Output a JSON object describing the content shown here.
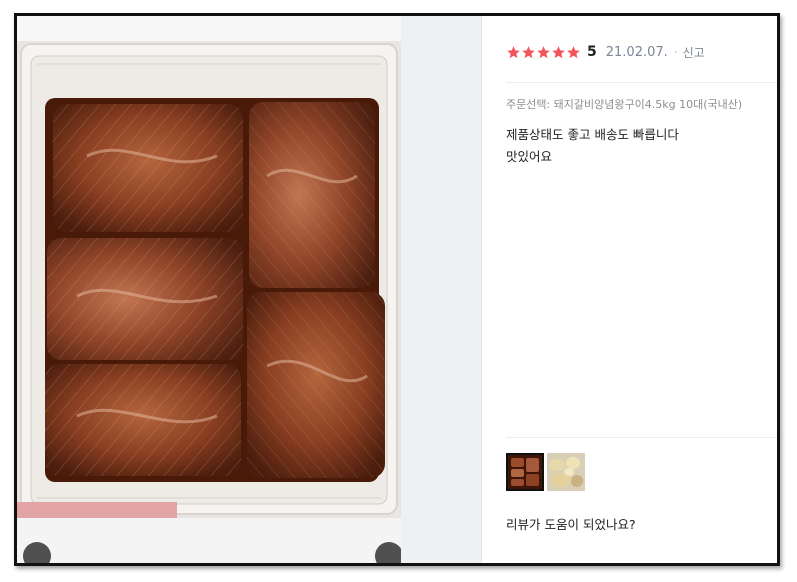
{
  "review": {
    "rating": 5,
    "score_label": "5",
    "date": "21.02.07.",
    "separator": "·",
    "report_label": "신고",
    "order_option": "주문선택: 돼지갈비양념왕구이4.5kg 10대(국내산)",
    "content_lines": [
      "제품상태도 좋고 배송도 빠릅니다",
      "맛있어요"
    ],
    "helpful_question": "리뷰가 도움이 되었나요?"
  },
  "photos": {
    "main_photo_icon": "marinated-pork-ribs-photo",
    "thumbnails": [
      "pork-ribs-thumbnail",
      "potato-thumbnail"
    ],
    "selected_index": 0
  },
  "colors": {
    "star": "#f2545b",
    "text": "#222222",
    "muted": "#7a8796"
  }
}
